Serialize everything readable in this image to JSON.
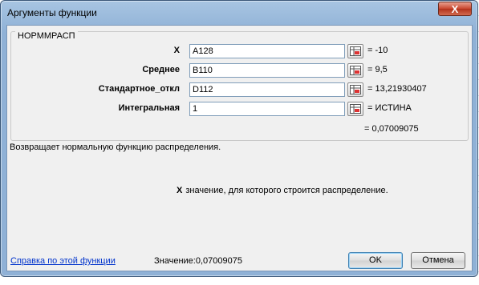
{
  "window": {
    "title": "Аргументы функции",
    "close_label": "X"
  },
  "function": {
    "name": "НОРММРАСП"
  },
  "arguments": [
    {
      "label": "X",
      "input": "A128",
      "value": "= -10"
    },
    {
      "label": "Среднее",
      "input": "B110",
      "value": "= 9,5"
    },
    {
      "label": "Стандартное_откл",
      "input": "D112",
      "value": "= 13,21930407"
    },
    {
      "label": "Интегральная",
      "input": "1",
      "value": "= ИСТИНА"
    }
  ],
  "result": "= 0,07009075",
  "description": "Возвращает нормальную функцию распределения.",
  "argument_help": {
    "name": "X",
    "text": "значение, для которого строится распределение."
  },
  "footer": {
    "help_link": "Справка по этой функции",
    "value_label": "Значение:",
    "value": "0,07009075",
    "ok_label": "OK",
    "cancel_label": "Отмена"
  }
}
